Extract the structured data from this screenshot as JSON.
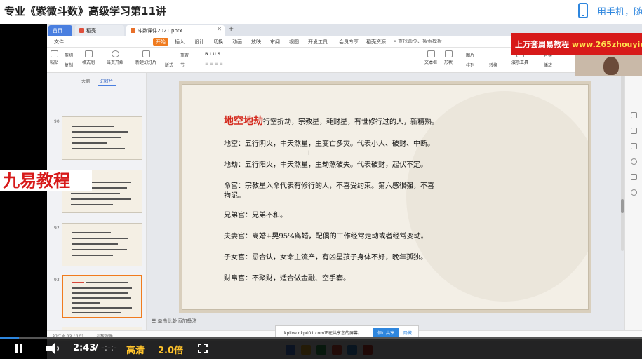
{
  "header": {
    "title": "专业《紫微斗数》高级学习第11讲",
    "mobile_prompt": "用手机，随时"
  },
  "app": {
    "tabs": [
      {
        "label": "首页"
      },
      {
        "label": "稻壳"
      },
      {
        "label": "斗数课件2021.pptx"
      }
    ],
    "menu": [
      "文件",
      "开始",
      "插入",
      "设计",
      "切换",
      "动画",
      "放映",
      "审阅",
      "视图",
      "开发工具",
      "会员专享",
      "稻壳资源"
    ],
    "menu_search": "查找命令、搜索模板",
    "ribbon": [
      "粘贴",
      "剪切",
      "复制",
      "格式刷",
      "当页开始",
      "新建幻灯片",
      "版式",
      "节",
      "重置",
      "文本框",
      "形状",
      "排列",
      "替换",
      "播放",
      "演示工具",
      "图片",
      "转换"
    ],
    "panel_tabs": [
      "大纲",
      "幻灯片"
    ],
    "thumb_numbers": [
      "90",
      "91",
      "92",
      "93",
      "94"
    ],
    "notes_placeholder": "单击此处添加备注",
    "status": [
      "幻灯片 93 / 101",
      "斗数课件"
    ]
  },
  "slide": {
    "heading": "地空地劫",
    "heading_rest": "行空折劫，宗教星，耗财星，有世修行过的人，新精熟。",
    "lines": [
      "地空：五行阴火，中天煞星，主变亡多灾。代表小人、破财、中断。",
      "地劫：五行阳火，中天煞星，主劫煞破失。代表破财，起伏不定。",
      "命宫：宗教星入命代表有修行的人，不喜受约束。第六感很强，不喜",
      "拘泥。",
      "兄弟宫：兄弟不和。",
      "夫妻宫：离婚+晃95%离婚，配偶的工作经常走动或者经常变动。",
      "子女宫：忌合认，女命主流产，有凶星孩子身体不好，晚年孤独。",
      "财帛宫：不聚财，适合做金融、空手套。"
    ]
  },
  "share_bar": {
    "text": "kplive.dkp001.com正在共享您的屏幕。",
    "stop": "停止共享",
    "hide": "隐藏"
  },
  "overlays": {
    "watermark_name": "上万套周易教程",
    "watermark_url": "www.265zhouyiw.com",
    "brand": "九易教程"
  },
  "player": {
    "current_time": "2:43",
    "separator": "/",
    "total_time": "-:-:-",
    "quality": "高清",
    "speed": "2.0倍",
    "progress": 0.03
  }
}
